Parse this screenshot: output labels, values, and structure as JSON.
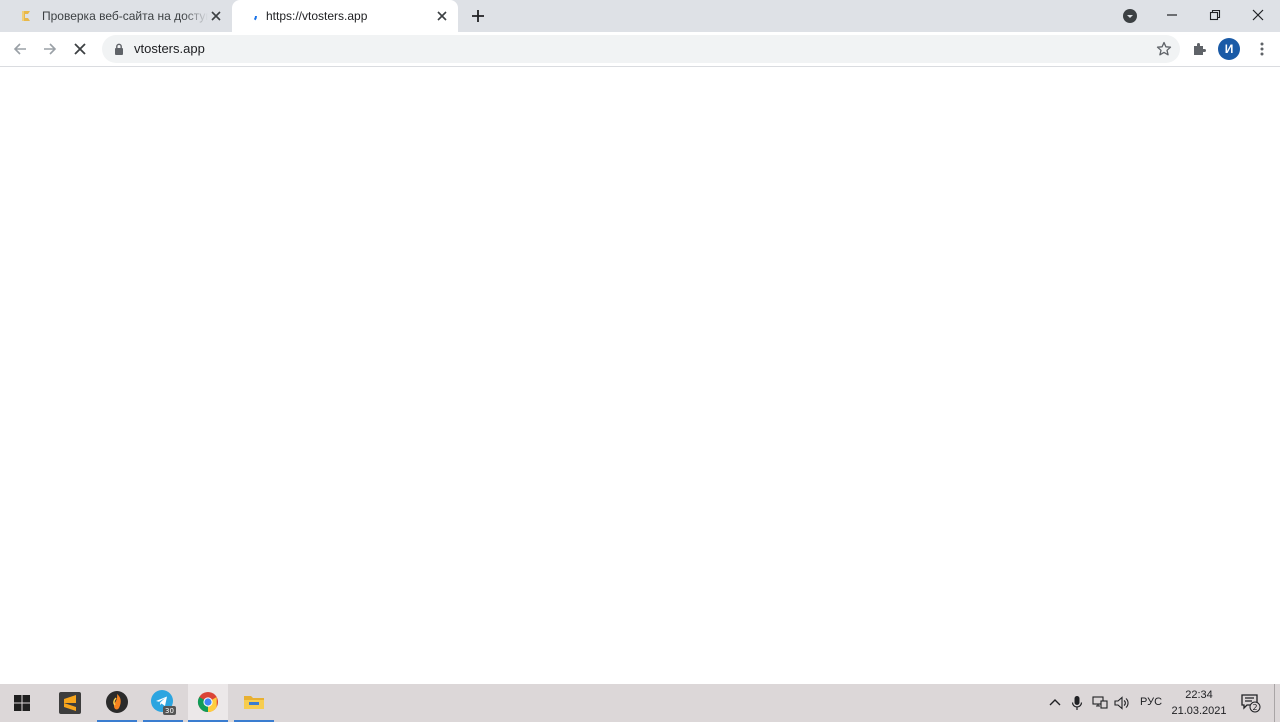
{
  "browser": {
    "tabs": [
      {
        "title": "Проверка веб-сайта на доступн",
        "favicon": "site-check-favicon"
      },
      {
        "title": "https://vtosters.app",
        "favicon": "loading-spinner"
      }
    ],
    "omnibox": {
      "url": "vtosters.app"
    },
    "profile_initial": "И"
  },
  "taskbar": {
    "apps": [
      "start-menu",
      "sublime-text",
      "fl-studio",
      "telegram",
      "chrome",
      "file-explorer"
    ],
    "telegram_badge": "30",
    "language": "РУС",
    "time": "22:34",
    "date": "21.03.2021",
    "notification_count": "2"
  },
  "colors": {
    "tabstrip": "#dee1e6",
    "taskbar": "#dcd7d8",
    "accent": "#3a7dd0",
    "avatar": "#1a5aa6"
  }
}
